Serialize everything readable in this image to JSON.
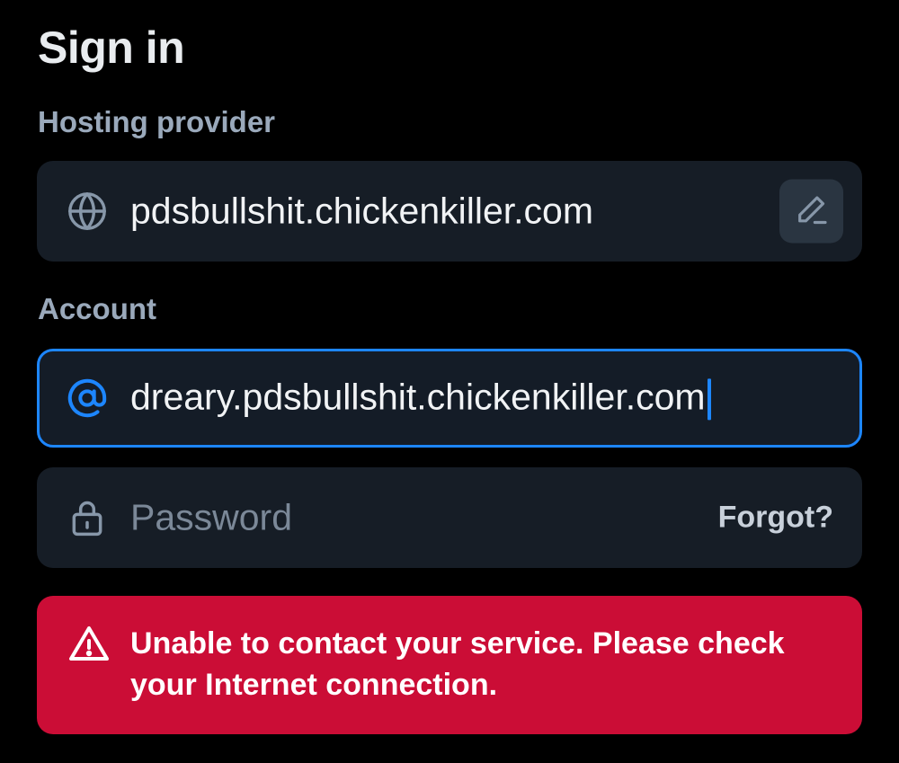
{
  "page": {
    "title": "Sign in"
  },
  "hosting": {
    "label": "Hosting provider",
    "value": "pdsbullshit.chickenkiller.com",
    "icon": "globe-icon",
    "edit_icon": "pencil-icon"
  },
  "account": {
    "label": "Account",
    "value": "dreary.pdsbullshit.chickenkiller.com",
    "icon": "at-sign-icon",
    "focused": true
  },
  "password": {
    "placeholder": "Password",
    "icon": "lock-icon",
    "forgot_label": "Forgot?"
  },
  "error": {
    "message": "Unable to contact your service. Please check your Internet connection.",
    "icon": "warning-icon"
  },
  "colors": {
    "background": "#000000",
    "field_bg": "#161d26",
    "accent": "#1d86ff",
    "error_bg": "#cb0d36",
    "label": "#9aa9bb"
  }
}
